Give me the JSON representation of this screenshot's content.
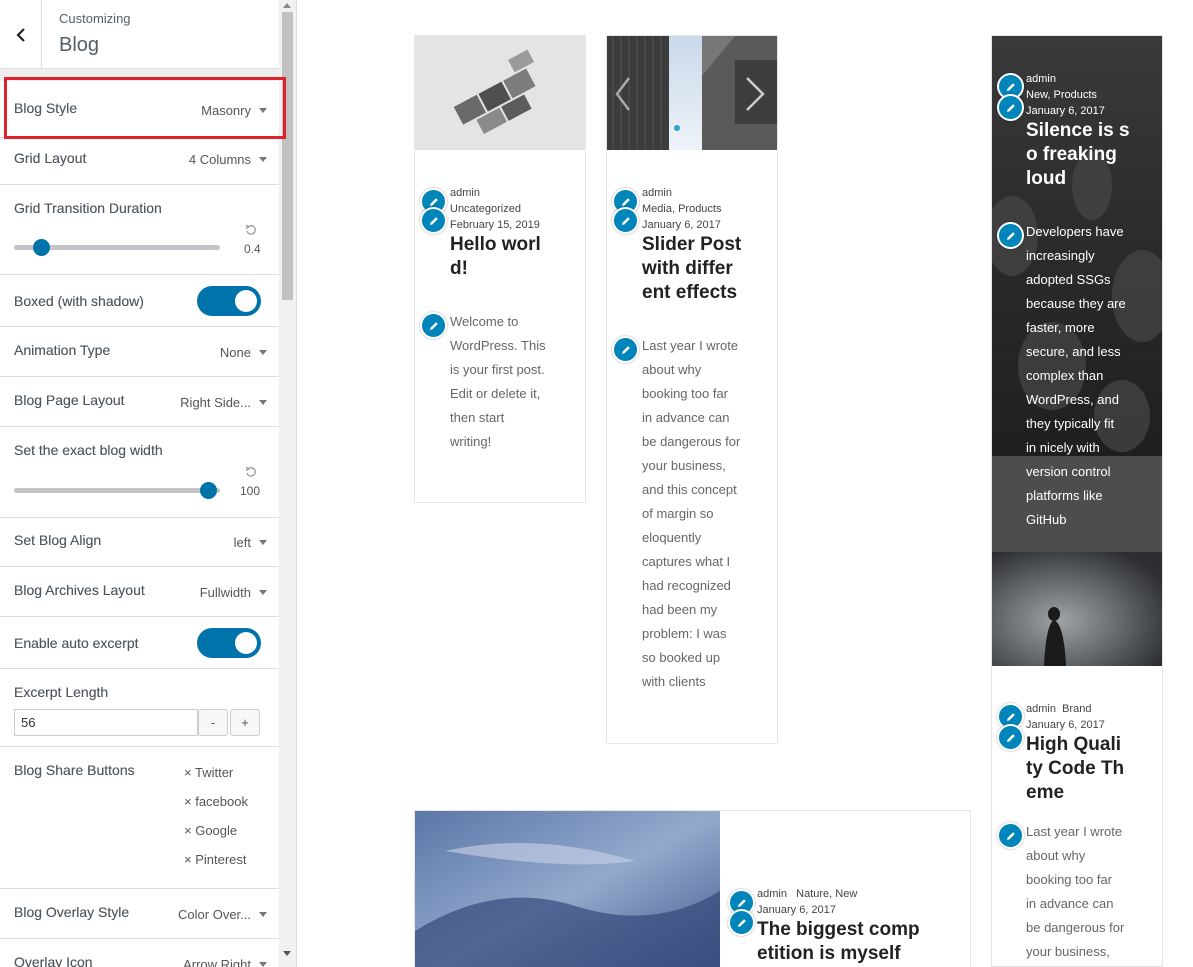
{
  "panel": {
    "customizing_label": "Customizing",
    "section_title": "Blog",
    "controls": {
      "blog_style": {
        "label": "Blog Style",
        "value": "Masonry"
      },
      "grid_layout": {
        "label": "Grid Layout",
        "value": "4 Columns"
      },
      "grid_transition": {
        "label": "Grid Transition Duration",
        "value": "0.4",
        "level": 0.13
      },
      "boxed": {
        "label": "Boxed (with shadow)",
        "checked": true
      },
      "animation_type": {
        "label": "Animation Type",
        "value": "None"
      },
      "blog_page_layout": {
        "label": "Blog Page Layout",
        "value": "Right Side..."
      },
      "blog_width": {
        "label": "Set the exact blog width",
        "value": "100",
        "level": 0.94
      },
      "blog_align": {
        "label": "Set Blog Align",
        "value": "left"
      },
      "archives_layout": {
        "label": "Blog Archives Layout",
        "value": "Fullwidth"
      },
      "auto_excerpt": {
        "label": "Enable auto excerpt",
        "checked": true
      },
      "excerpt_length": {
        "label": "Excerpt Length",
        "value": "56",
        "minus": "-",
        "plus": "+"
      },
      "share_buttons": {
        "label": "Blog Share Buttons",
        "items": [
          "× Twitter",
          "× facebook",
          "× Google",
          "× Pinterest"
        ]
      },
      "overlay_style": {
        "label": "Blog Overlay Style",
        "value": "Color Over..."
      },
      "overlay_icon": {
        "label": "Overlay Icon",
        "value": "Arrow Right"
      }
    }
  },
  "colors": {
    "accent": "#0073aa",
    "highlight": "#e0202a",
    "panel_bg": "#eeeeee"
  },
  "posts": [
    {
      "author": "admin",
      "category": "Uncategorized",
      "date": "February 15, 2019",
      "title_lines": [
        "Hello worl",
        "d!"
      ],
      "excerpt_lines": [
        "Welcome to",
        "WordPress. This",
        "is your first post.",
        "Edit or delete it,",
        "then start",
        "writing!"
      ]
    },
    {
      "author": "admin",
      "category": "Media, Products",
      "date": "January 6, 2017",
      "title_lines": [
        "Slider Post",
        "with differ",
        "ent effects"
      ],
      "excerpt_lines": [
        "Last year I wrote",
        "about why",
        "booking too far",
        "in advance can",
        "be dangerous for",
        "your business,",
        "and this concept",
        "of margin so",
        "eloquently",
        "captures what I",
        "had recognized",
        "had been my",
        "problem: I was",
        "so booked up",
        "with clients"
      ]
    },
    {
      "author": "admin",
      "category": "New, Products",
      "date": "January 6, 2017",
      "title_lines": [
        "Silence is s",
        "o freaking",
        "loud"
      ],
      "excerpt_lines": [
        "Developers have",
        "increasingly",
        "adopted SSGs",
        "because they are",
        "faster, more",
        "secure, and less",
        "complex than",
        "WordPress, and",
        "they typically fit",
        "in nicely with",
        "version control",
        "platforms like",
        "GitHub"
      ]
    },
    {
      "author": "admin",
      "category": "Brand",
      "date": "January 6, 2017",
      "title_lines": [
        "High Quali",
        "ty Code Th",
        "eme"
      ],
      "excerpt_lines": [
        "Last year I wrote",
        "about why",
        "booking too far",
        "in advance can",
        "be dangerous for",
        "your business,"
      ]
    },
    {
      "author": "admin",
      "category": "Nature, New",
      "date": "January 6, 2017",
      "title_lines": [
        "The biggest comp",
        "etition is myself"
      ]
    }
  ]
}
